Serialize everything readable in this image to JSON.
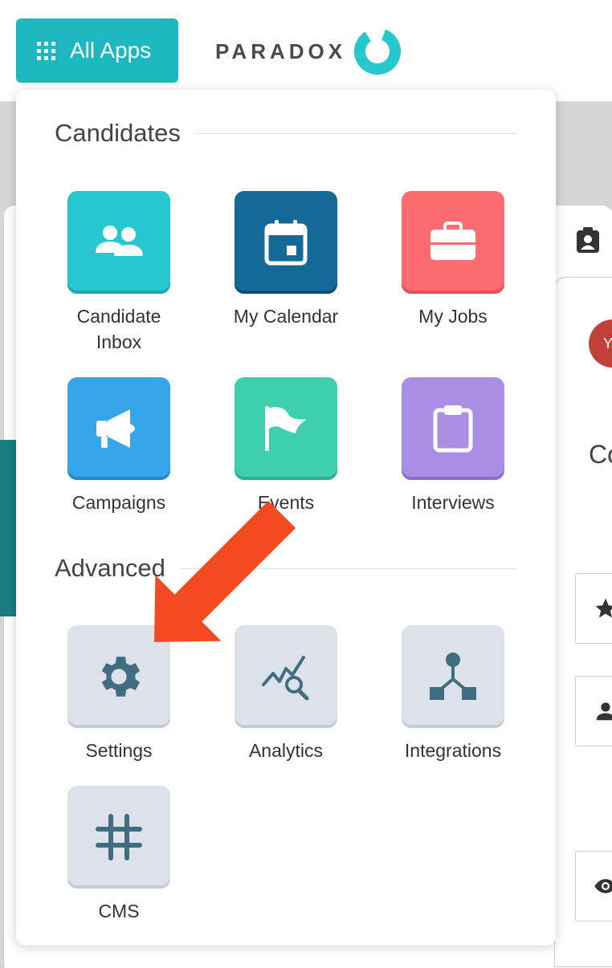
{
  "header": {
    "all_apps_label": "All Apps",
    "logo_text": "PARADOX"
  },
  "background": {
    "avatar_letter": "Y",
    "partial_text": "Co"
  },
  "sections": [
    {
      "title": "Candidates"
    },
    {
      "title": "Advanced"
    }
  ],
  "apps": {
    "candidate_inbox": {
      "label_line1": "Candidate",
      "label_line2": "Inbox",
      "color": "#27c7cf",
      "icon": "users-icon"
    },
    "my_calendar": {
      "label": "My Calendar",
      "color": "#146a96",
      "icon": "calendar-icon"
    },
    "my_jobs": {
      "label": "My Jobs",
      "color": "#fc6b70",
      "icon": "briefcase-icon"
    },
    "campaigns": {
      "label": "Campaigns",
      "color": "#35a6ea",
      "icon": "megaphone-icon"
    },
    "events": {
      "label": "Events",
      "color": "#3dcfae",
      "icon": "flag-icon"
    },
    "interviews": {
      "label": "Interviews",
      "color": "#a98ee3",
      "icon": "clipboard-icon"
    },
    "settings": {
      "label": "Settings",
      "color": "#dde2ea",
      "icon": "gear-icon"
    },
    "analytics": {
      "label": "Analytics",
      "color": "#dde2ea",
      "icon": "analytics-icon"
    },
    "integrations": {
      "label": "Integrations",
      "color": "#dde2ea",
      "icon": "integrations-icon"
    },
    "cms": {
      "label": "CMS",
      "color": "#dde2ea",
      "icon": "hash-icon"
    }
  },
  "colors": {
    "brand_teal": "#1db8bf",
    "advanced_icon": "#3f6e80",
    "annotation_arrow": "#f44a22"
  }
}
